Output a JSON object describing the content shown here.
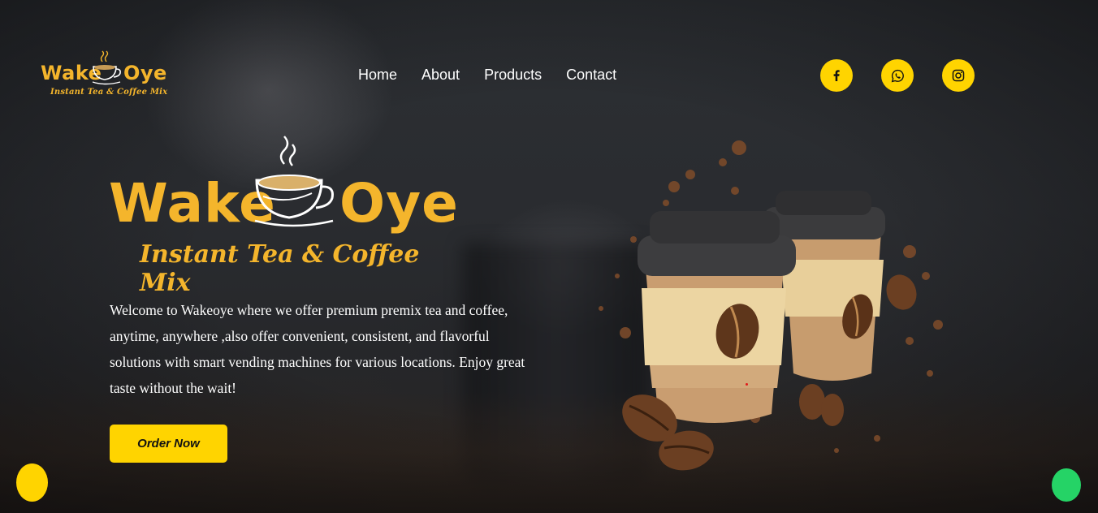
{
  "brand": {
    "name_left": "Wake",
    "name_right": "Oye",
    "tagline": "Instant Tea & Coffee Mix",
    "color": "#f4b52c"
  },
  "nav": {
    "items": [
      {
        "label": "Home"
      },
      {
        "label": "About"
      },
      {
        "label": "Products"
      },
      {
        "label": "Contact"
      }
    ]
  },
  "social": [
    {
      "icon": "facebook-icon"
    },
    {
      "icon": "whatsapp-icon"
    },
    {
      "icon": "instagram-icon"
    }
  ],
  "hero": {
    "description": "Welcome to Wakeoye where we offer premium premix tea and coffee, anytime, anywhere ,also offer convenient, consistent, and flavorful solutions with smart vending machines for various locations. Enjoy great taste without the wait!",
    "cta_label": "Order Now"
  },
  "floating": {
    "left_glyph": "",
    "right_glyph": ""
  },
  "colors": {
    "accent": "#ffd400",
    "whatsapp": "#25d366",
    "background": "#26282b"
  }
}
